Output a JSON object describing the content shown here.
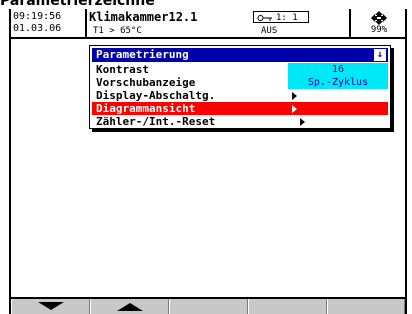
{
  "page": {
    "heading": "Parametrierzeichne"
  },
  "header": {
    "time": "09:19:56",
    "date": "01.03.06",
    "title": "Klimakammer12.1",
    "channel": "1: 1",
    "info": "T1 > 65°C",
    "status": "AUS",
    "network_icon": "network-icon",
    "percent": "99%"
  },
  "menu": {
    "title": "Parametrierung",
    "close_icon": "close-icon",
    "items": [
      {
        "label": "Kontrast",
        "value": "16"
      },
      {
        "label": "Vorschubanzeige",
        "value": "Sp.-Zyklus"
      },
      {
        "label": "Display-Abschaltg."
      },
      {
        "label": "Diagrammansicht",
        "selected": true
      },
      {
        "label": "Zähler-/Int.-Reset"
      }
    ]
  },
  "softkeys": [
    {
      "icon": "arrow-down-icon"
    },
    {
      "icon": "arrow-up-icon"
    },
    {
      "icon": ""
    },
    {
      "icon": ""
    },
    {
      "icon": ""
    }
  ],
  "colors": {
    "title_bar": "#0000a8",
    "selected_row": "#ff0000",
    "value_highlight": "#00e8f8",
    "softkey_bar": "#c8c8c8"
  }
}
